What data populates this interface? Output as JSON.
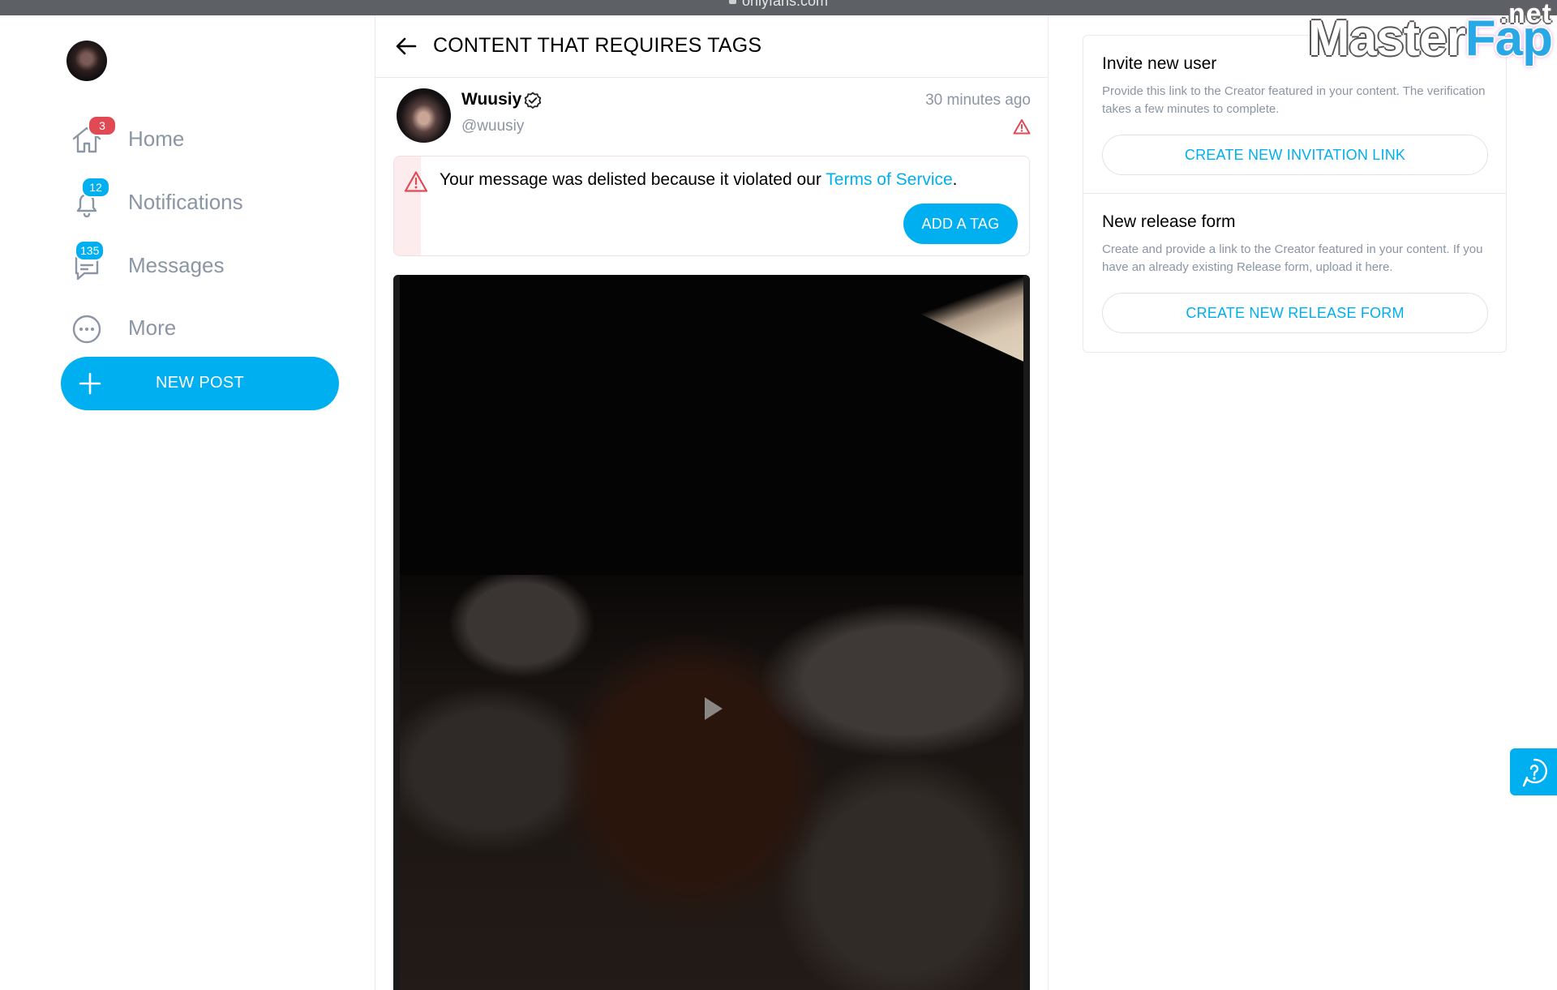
{
  "browser": {
    "url": "onlyfans.com"
  },
  "watermark": {
    "part1": "Master",
    "part2": "Fap",
    "suffix": ".net"
  },
  "sidebar": {
    "items": [
      {
        "label": "Home",
        "icon": "home-icon",
        "badge": "3",
        "badge_color": "#e14a55"
      },
      {
        "label": "Notifications",
        "icon": "bell-icon",
        "badge": "12",
        "badge_color": "#00aff0"
      },
      {
        "label": "Messages",
        "icon": "message-icon",
        "badge": "135",
        "badge_color": "#00aff0"
      },
      {
        "label": "More",
        "icon": "more-dots-icon",
        "badge": null
      }
    ],
    "new_post_label": "NEW POST"
  },
  "main": {
    "title": "CONTENT THAT REQUIRES TAGS",
    "post": {
      "name": "Wuusiy",
      "handle": "@wuusiy",
      "time": "30 minutes ago",
      "notice_prefix": "Your message was delisted because it violated our ",
      "notice_link": "Terms of Service",
      "notice_suffix": ".",
      "add_tag_label": "ADD A TAG"
    }
  },
  "right": {
    "invite": {
      "title": "Invite new user",
      "description": "Provide this link to the Creator featured in your content. The verification takes a few minutes to complete.",
      "button": "CREATE NEW INVITATION LINK"
    },
    "release": {
      "title": "New release form",
      "description": "Create and provide a link to the Creator featured in your content. If you have an already existing Release form, upload it here.",
      "button": "CREATE NEW RELEASE FORM"
    }
  },
  "colors": {
    "accent": "#00aff0",
    "muted_text": "#8a96a3",
    "alert": "#e14a55"
  }
}
